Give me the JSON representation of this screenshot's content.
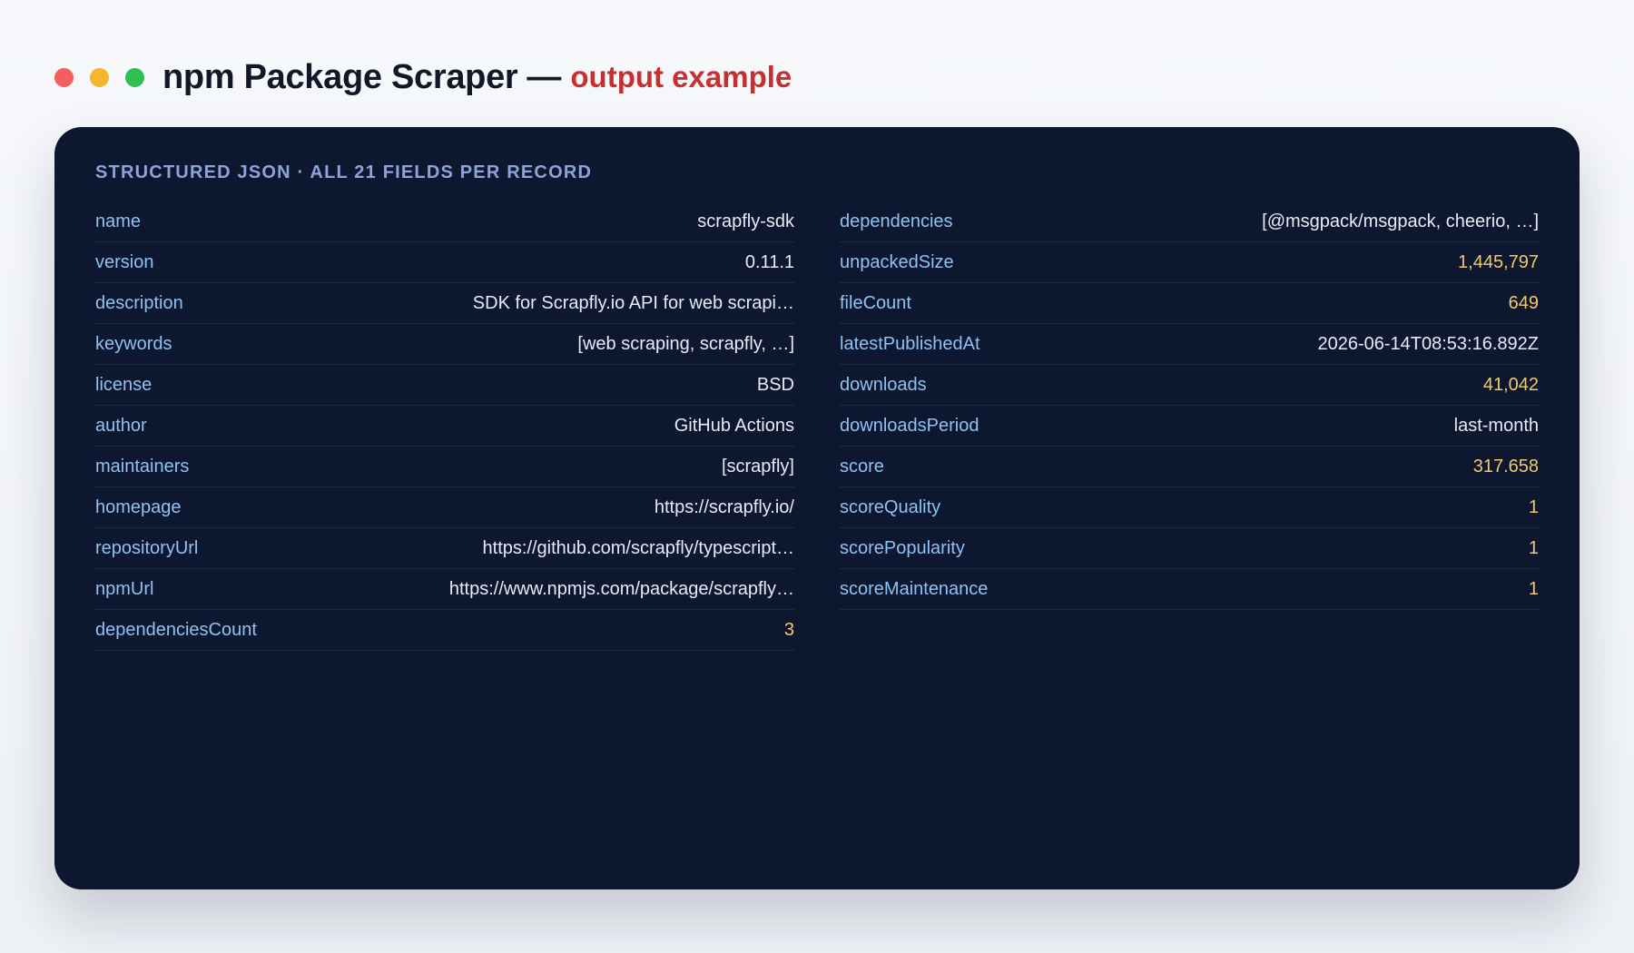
{
  "window": {
    "title": "npm Package Scraper",
    "dash": "—",
    "subtitle": "output example"
  },
  "colors": {
    "close": "#f25f5c",
    "minimize": "#f5b52e",
    "maximize": "#2ec050",
    "accent": "#c53030",
    "panel_bg": "#0e1730",
    "key": "#8ec2f2",
    "value": "#e6ebf5",
    "number": "#f2c96a"
  },
  "panel": {
    "heading": "STRUCTURED JSON · ALL 21 FIELDS PER RECORD"
  },
  "left": [
    {
      "key": "name",
      "value": "scrapfly-sdk",
      "numeric": false
    },
    {
      "key": "version",
      "value": "0.11.1",
      "numeric": false
    },
    {
      "key": "description",
      "value": "SDK for Scrapfly.io API for web scrapi…",
      "numeric": false
    },
    {
      "key": "keywords",
      "value": "[web scraping, scrapfly, …]",
      "numeric": false
    },
    {
      "key": "license",
      "value": "BSD",
      "numeric": false
    },
    {
      "key": "author",
      "value": "GitHub Actions",
      "numeric": false
    },
    {
      "key": "maintainers",
      "value": "[scrapfly]",
      "numeric": false
    },
    {
      "key": "homepage",
      "value": "https://scrapfly.io/",
      "numeric": false
    },
    {
      "key": "repositoryUrl",
      "value": "https://github.com/scrapfly/typescript…",
      "numeric": false
    },
    {
      "key": "npmUrl",
      "value": "https://www.npmjs.com/package/scrapfly…",
      "numeric": false
    },
    {
      "key": "dependenciesCount",
      "value": "3",
      "numeric": true
    }
  ],
  "right": [
    {
      "key": "dependencies",
      "value": "[@msgpack/msgpack, cheerio, …]",
      "numeric": false
    },
    {
      "key": "unpackedSize",
      "value": "1,445,797",
      "numeric": true
    },
    {
      "key": "fileCount",
      "value": "649",
      "numeric": true
    },
    {
      "key": "latestPublishedAt",
      "value": "2026-06-14T08:53:16.892Z",
      "numeric": false
    },
    {
      "key": "downloads",
      "value": "41,042",
      "numeric": true
    },
    {
      "key": "downloadsPeriod",
      "value": "last-month",
      "numeric": false
    },
    {
      "key": "score",
      "value": "317.658",
      "numeric": true
    },
    {
      "key": "scoreQuality",
      "value": "1",
      "numeric": true
    },
    {
      "key": "scorePopularity",
      "value": "1",
      "numeric": true
    },
    {
      "key": "scoreMaintenance",
      "value": "1",
      "numeric": true
    }
  ]
}
